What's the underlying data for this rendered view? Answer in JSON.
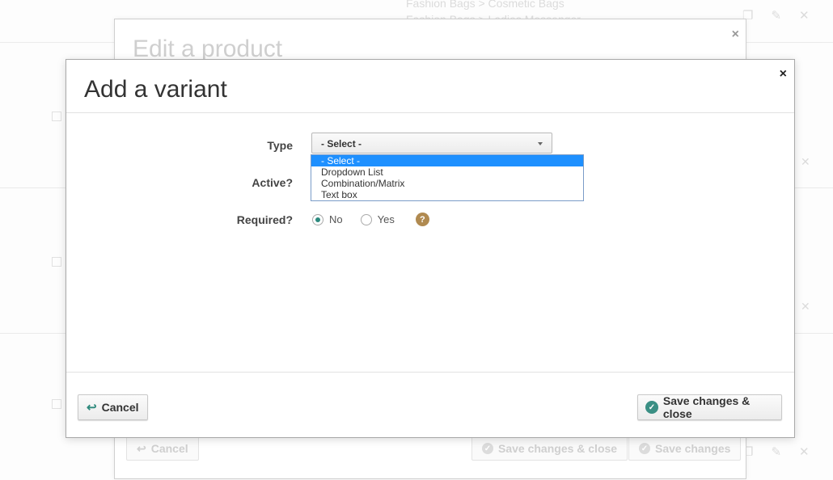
{
  "background": {
    "breadcrumbs": [
      "Fashion Bags > Cosmetic Bags",
      "Fashion Bags > Ladies Messenger"
    ]
  },
  "edit_modal": {
    "title": "Edit a product",
    "close_glyph": "×",
    "cancel_label": "Cancel",
    "save_close_label": "Save changes & close",
    "save_label": "Save changes"
  },
  "variant_modal": {
    "title": "Add a variant",
    "close_glyph": "×",
    "type": {
      "label": "Type",
      "selected": "- Select -",
      "options": [
        "- Select -",
        "Dropdown List",
        "Combination/Matrix",
        "Text box"
      ]
    },
    "active": {
      "label": "Active?"
    },
    "required": {
      "label": "Required?",
      "options": [
        {
          "label": "No",
          "checked": true
        },
        {
          "label": "Yes",
          "checked": false
        }
      ],
      "help_glyph": "?"
    },
    "footer": {
      "cancel_label": "Cancel",
      "save_close_label": "Save changes & close"
    }
  },
  "colors": {
    "accent_teal": "#3a8f84",
    "help_badge": "#b08a50",
    "selected_option": "#1e90ff"
  },
  "icons": {
    "reply": "reply-arrow-icon",
    "check": "check-circle-icon",
    "edit": "pencil-icon",
    "copy": "copy-icon",
    "delete": "close-icon"
  }
}
